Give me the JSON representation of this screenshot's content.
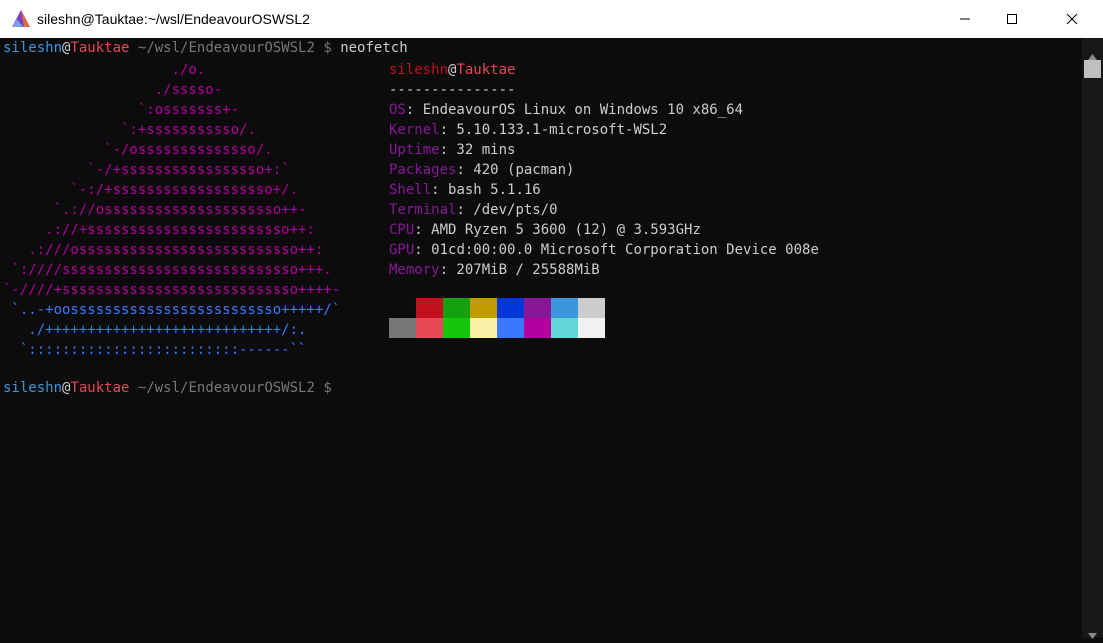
{
  "window": {
    "title": "sileshn@Tauktae:~/wsl/EndeavourOSWSL2",
    "app_icon": "endeavouros-logo-icon",
    "controls": [
      "minimize-icon",
      "maximize-icon",
      "close-icon"
    ]
  },
  "prompt": {
    "user": "sileshn",
    "at": "@",
    "host": "Tauktae",
    "path": " ~/wsl/EndeavourOSWSL2 $",
    "command": " neofetch"
  },
  "logo": {
    "lines": [
      {
        "text": "                    ./o.",
        "color": "#b4009e"
      },
      {
        "text": "                  ./sssso-",
        "color": "#b4009e"
      },
      {
        "text": "                `:osssssss+-",
        "color": "#b4009e"
      },
      {
        "text": "              `:+sssssssssso/.",
        "color": "#b4009e"
      },
      {
        "text": "            `-/ossssssssssssso/.",
        "color": "#b4009e"
      },
      {
        "text": "          `-/+sssssssssssssssso+:`",
        "color": "#b4009e"
      },
      {
        "text": "        `-:/+sssssssssssssssssso+/.",
        "color": "#b4009e"
      },
      {
        "text": "      `.://osssssssssssssssssssso++-",
        "color": "#b4009e"
      },
      {
        "text": "     .://+ssssssssssssssssssssssso++:",
        "color": "#b4009e"
      },
      {
        "text": "   .:///ossssssssssssssssssssssssso++:",
        "color": "#b4009e"
      },
      {
        "text": " `:////ssssssssssssssssssssssssssso+++.",
        "color": "#b4009e"
      },
      {
        "text": "`-////+ssssssssssssssssssssssssssso++++-",
        "color": "#b4009e"
      },
      {
        "text": " `..-+oosssssssssssssssssssssssso+++++/`",
        "color": "#3b78ff"
      },
      {
        "text": "   ./++++++++++++++++++++++++++++/:.",
        "color": "#3b78ff"
      },
      {
        "text": "  `:::::::::::::::::::::::::------``",
        "color": "#3b78ff"
      }
    ]
  },
  "info": {
    "user": "sileshn",
    "at": "@",
    "host": "Tauktae",
    "separator": "---------------",
    "entries": [
      {
        "key": "OS",
        "value": ": EndeavourOS Linux on Windows 10 x86_64"
      },
      {
        "key": "Kernel",
        "value": ": 5.10.133.1-microsoft-WSL2"
      },
      {
        "key": "Uptime",
        "value": ": 32 mins"
      },
      {
        "key": "Packages",
        "value": ": 420 (pacman)"
      },
      {
        "key": "Shell",
        "value": ": bash 5.1.16"
      },
      {
        "key": "Terminal",
        "value": ": /dev/pts/0"
      },
      {
        "key": "CPU",
        "value": ": AMD Ryzen 5 3600 (12) @ 3.593GHz"
      },
      {
        "key": "GPU",
        "value": ": 01cd:00:00.0 Microsoft Corporation Device 008e"
      },
      {
        "key": "Memory",
        "value": ": 207MiB / 25588MiB"
      }
    ]
  },
  "palette": {
    "normal": [
      "#0c0c0c",
      "#c50f1f",
      "#13a10e",
      "#c19c00",
      "#0037da",
      "#881798",
      "#3a96dd",
      "#cccccc"
    ],
    "bright": [
      "#767676",
      "#e74856",
      "#16c60c",
      "#f9f1a5",
      "#3b78ff",
      "#b4009e",
      "#61d6d6",
      "#f2f2f2"
    ]
  },
  "prompt2": {
    "user": "sileshn",
    "at": "@",
    "host": "Tauktae",
    "path": " ~/wsl/EndeavourOSWSL2 $"
  }
}
